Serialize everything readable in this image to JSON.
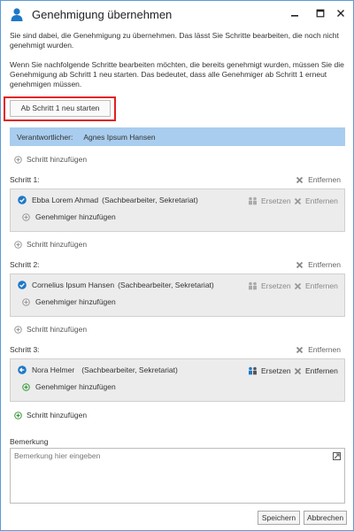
{
  "window": {
    "title": "Genehmigung übernehmen",
    "icon": "user-icon",
    "controls": [
      "minimize-icon",
      "maximize-icon",
      "close-icon"
    ]
  },
  "intro": {
    "paragraph1": "Sie sind dabei, die Genehmigung zu übernehmen. Das lässt Sie Schritte bearbeiten, die noch nicht genehmigt wurden.",
    "paragraph2": "Wenn Sie nachfolgende Schritte bearbeiten möchten, die bereits genehmigt wurden, müssen Sie die Genehmigung ab Schritt 1 neu starten. Das bedeutet, dass alle Genehmiger ab Schritt 1 erneut genehmigen müssen."
  },
  "restart_button": "Ab Schritt 1 neu starten",
  "responsible": {
    "label": "Verantwortlicher:",
    "name": "Agnes Ipsum Hansen"
  },
  "add_step_label": "Schritt hinzufügen",
  "add_approver_label": "Genehmiger hinzufügen",
  "remove_label": "Entfernen",
  "replace_label": "Ersetzen",
  "steps": [
    {
      "title": "Schritt 1:",
      "approver": "Ebba Lorem Ahmad",
      "role": "(Sachbearbeiter, Sekretariat)",
      "status_icon": "check-circle-icon"
    },
    {
      "title": "Schritt 2:",
      "approver": "Cornelius Ipsum Hansen",
      "role": "(Sachbearbeiter, Sekretariat)",
      "status_icon": "check-circle-icon"
    },
    {
      "title": "Schritt 3:",
      "approver": "Nora Helmer",
      "role": "(Sachbearbeiter, Sekretariat)",
      "status_icon": "arrow-left-circle-icon"
    }
  ],
  "remark": {
    "label": "Bemerkung",
    "placeholder": "Bemerkung hier eingeben"
  },
  "footer": {
    "save": "Speichern",
    "cancel": "Abbrechen"
  },
  "colors": {
    "accent": "#1e78c8",
    "responsible_bar": "#a9cdee",
    "highlight_frame": "#e02020",
    "add_green": "#3a9a3a"
  }
}
